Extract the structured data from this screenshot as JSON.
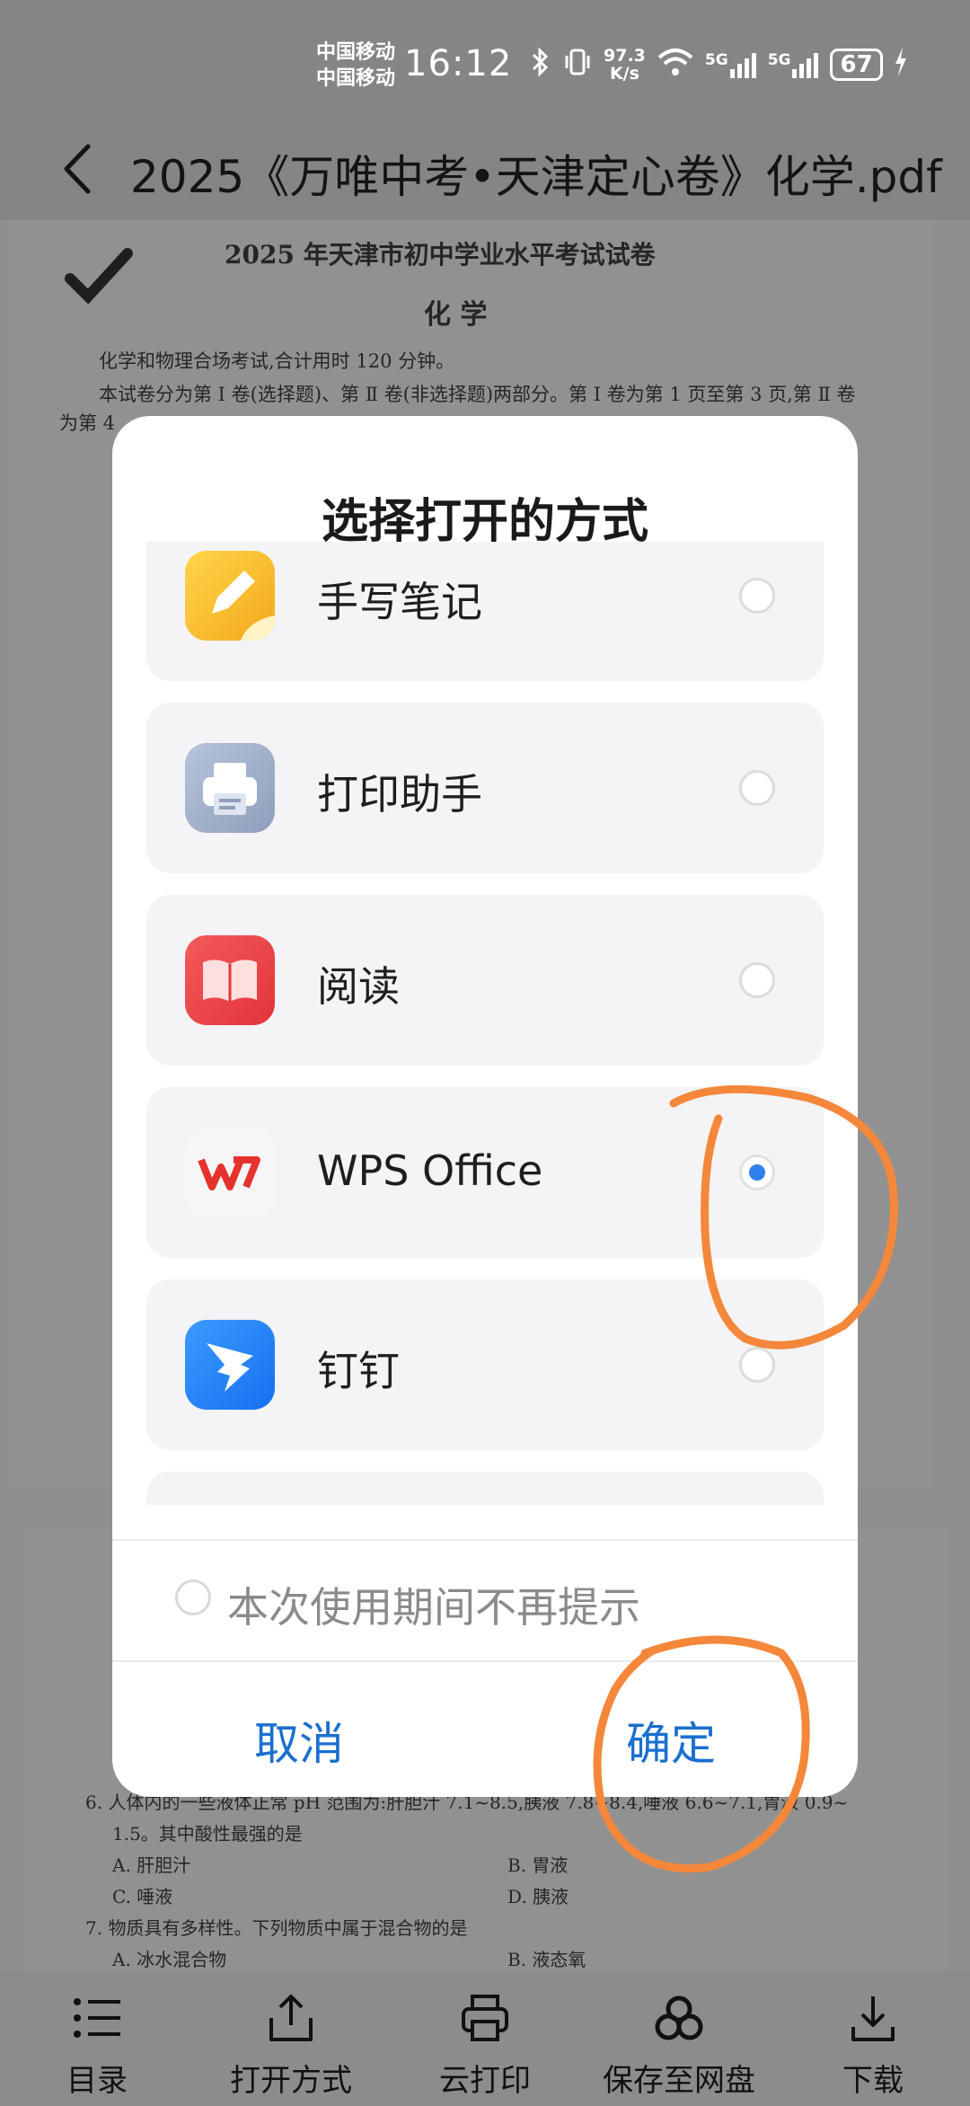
{
  "status_bar": {
    "carrier_1": "中国移动",
    "carrier_2": "中国移动",
    "time": "16:12",
    "speed_value": "97.3",
    "speed_unit": "K/s",
    "network_1": "5G",
    "network_2": "5G",
    "battery": "67"
  },
  "header": {
    "title": "2025《万唯中考•天津定心卷》化学.pdf"
  },
  "document": {
    "heading": "2025 年天津市初中学业水平考试试卷",
    "subject": "化 学",
    "line_1": "化学和物理合场考试,合计用时 120 分钟。",
    "line_2": "本试卷分为第 Ⅰ 卷(选择题)、第 Ⅱ 卷(非选择题)两部分。第 Ⅰ 卷为第 1 页至第 3 页,第 Ⅱ 卷",
    "line_3": "为第 4",
    "q6": "6. 人体内的一些液体正常 pH 范围为:肝胆汁 7.1~8.5,胰液 7.8~8.4,唾液 6.6~7.1,胃液 0.9~",
    "q6b": "1.5。其中酸性最强的是",
    "q6_a": "A. 肝胆汁",
    "q6_b": "B. 胃液",
    "q6_c": "C. 唾液",
    "q6_d": "D. 胰液",
    "q7": "7. 物质具有多样性。下列物质中属于混合物的是",
    "q7_a": "A. 冰水混合物",
    "q7_b": "B. 液态氧"
  },
  "dialog": {
    "title": "选择打开的方式",
    "options": [
      {
        "label": "手写笔记",
        "icon": "pencil-note-icon",
        "selected": false
      },
      {
        "label": "打印助手",
        "icon": "printer-icon",
        "selected": false
      },
      {
        "label": "阅读",
        "icon": "book-icon",
        "selected": false
      },
      {
        "label": "WPS Office",
        "icon": "wps-icon",
        "selected": true
      },
      {
        "label": "钉钉",
        "icon": "dingtalk-icon",
        "selected": false
      }
    ],
    "no_prompt_label": "本次使用期间不再提示",
    "cancel_label": "取消",
    "confirm_label": "确定",
    "accent_color": "#1a6fcf"
  },
  "toolbar": {
    "items": [
      {
        "label": "目录",
        "icon": "list-icon"
      },
      {
        "label": "打开方式",
        "icon": "share-icon"
      },
      {
        "label": "云打印",
        "icon": "printer-icon"
      },
      {
        "label": "保存至网盘",
        "icon": "cloud-drive-icon"
      },
      {
        "label": "下载",
        "icon": "download-icon"
      }
    ]
  },
  "annotation_color": "#f5873a"
}
